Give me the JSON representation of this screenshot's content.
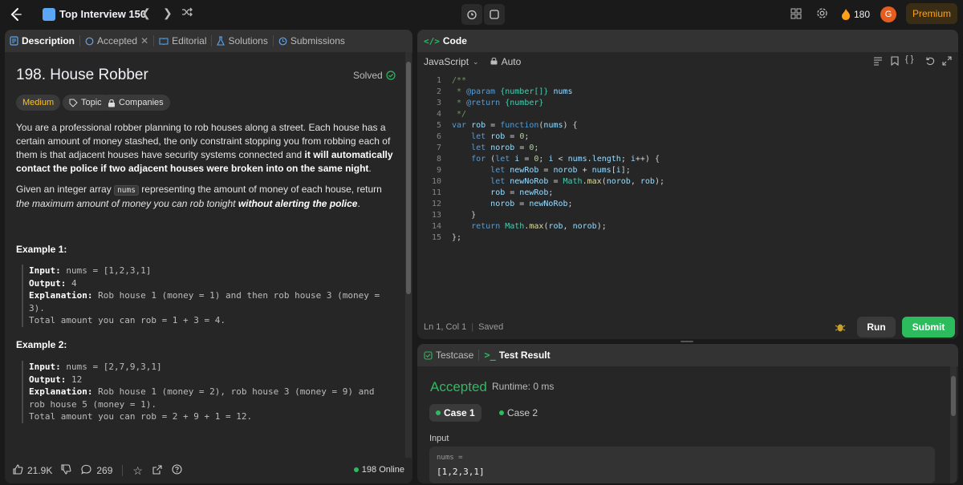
{
  "topbar": {
    "list_title": "Top Interview 150",
    "prev_icon": "chevron-left-icon",
    "next_icon": "chevron-right-icon",
    "shuffle_icon": "shuffle-icon",
    "streak": "180",
    "avatar_initial": "G",
    "premium_label": "Premium"
  },
  "left_tabs": [
    {
      "label": "Description",
      "icon": "document-icon"
    },
    {
      "label": "Accepted",
      "icon": "history-icon"
    },
    {
      "label": "Editorial",
      "icon": "book-icon"
    },
    {
      "label": "Solutions",
      "icon": "flask-icon"
    },
    {
      "label": "Submissions",
      "icon": "history-icon"
    }
  ],
  "problem": {
    "title": "198. House Robber",
    "status": "Solved",
    "difficulty": "Medium",
    "topics_label": "Topics",
    "companies_label": "Companies",
    "para1_a": "You are a professional robber planning to rob houses along a street. Each house has a certain amount of money stashed, the only constraint stopping you from robbing each of them is that adjacent houses have security systems connected and ",
    "para1_b": "it will automatically contact the police if two adjacent houses were broken into on the same night",
    "para1_c": ".",
    "para2_a": "Given an integer array ",
    "para2_code": "nums",
    "para2_b": " representing the amount of money of each house, return ",
    "para2_c": "the maximum amount of money you can rob tonight ",
    "para2_d": "without alerting the police",
    "para2_e": ".",
    "example1_title": "Example 1:",
    "example2_title": "Example 2:"
  },
  "examples": [
    {
      "input_label": "Input:",
      "input_value": " nums = [1,2,3,1]",
      "output_label": "Output:",
      "output_value": " 4",
      "explanation_label": "Explanation:",
      "explanation_value": " Rob house 1 (money = 1) and then rob house 3 (money = 3).",
      "total": "Total amount you can rob = 1 + 3 = 4."
    },
    {
      "input_label": "Input:",
      "input_value": " nums = [2,7,9,3,1]",
      "output_label": "Output:",
      "output_value": " 12",
      "explanation_label": "Explanation:",
      "explanation_value": " Rob house 1 (money = 2), rob house 3 (money = 9) and rob house 5 (money = 1).",
      "total": "Total amount you can rob = 2 + 9 + 1 = 12."
    }
  ],
  "footer": {
    "likes": "21.9K",
    "comments": "269",
    "online": "198 Online"
  },
  "code_panel": {
    "title": "Code",
    "language": "JavaScript",
    "mode": "Auto",
    "line_numbers": [
      "1",
      "2",
      "3",
      "4",
      "5",
      "6",
      "7",
      "8",
      "9",
      "10",
      "11",
      "12",
      "13",
      "14",
      "15"
    ],
    "status_position": "Ln 1, Col 1",
    "status_saved": "Saved",
    "run_label": "Run",
    "submit_label": "Submit"
  },
  "test_panel": {
    "testcase_tab": "Testcase",
    "result_tab": "Test Result",
    "result": "Accepted",
    "runtime": "Runtime: 0 ms",
    "cases": [
      "Case 1",
      "Case 2"
    ],
    "input_label": "Input",
    "input_name": "nums =",
    "input_value": "[1,2,3,1]"
  },
  "colors": {
    "accent_green": "#2cbb5d",
    "medium": "#ffc01e",
    "premium": "#ffa116",
    "background": "#1a1a1a",
    "panel": "#262626"
  }
}
